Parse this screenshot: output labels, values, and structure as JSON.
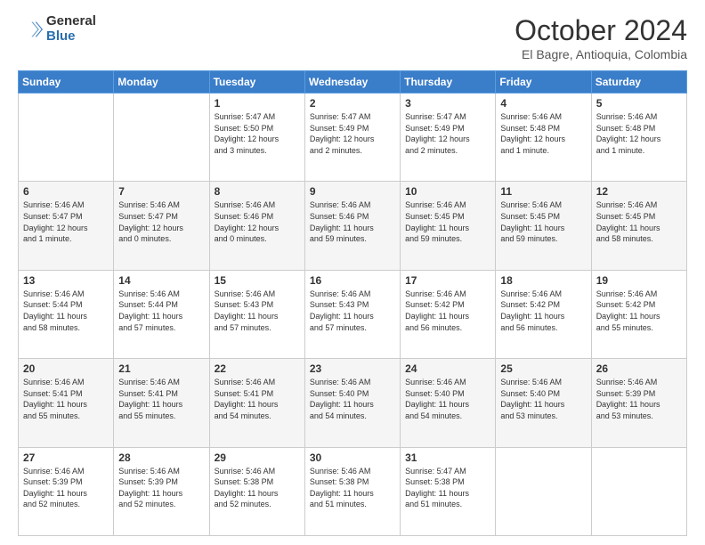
{
  "header": {
    "logo": {
      "general": "General",
      "blue": "Blue"
    },
    "title": "October 2024",
    "location": "El Bagre, Antioquia, Colombia"
  },
  "days_of_week": [
    "Sunday",
    "Monday",
    "Tuesday",
    "Wednesday",
    "Thursday",
    "Friday",
    "Saturday"
  ],
  "weeks": [
    [
      {
        "day": "",
        "content": ""
      },
      {
        "day": "",
        "content": ""
      },
      {
        "day": "1",
        "content": "Sunrise: 5:47 AM\nSunset: 5:50 PM\nDaylight: 12 hours\nand 3 minutes."
      },
      {
        "day": "2",
        "content": "Sunrise: 5:47 AM\nSunset: 5:49 PM\nDaylight: 12 hours\nand 2 minutes."
      },
      {
        "day": "3",
        "content": "Sunrise: 5:47 AM\nSunset: 5:49 PM\nDaylight: 12 hours\nand 2 minutes."
      },
      {
        "day": "4",
        "content": "Sunrise: 5:46 AM\nSunset: 5:48 PM\nDaylight: 12 hours\nand 1 minute."
      },
      {
        "day": "5",
        "content": "Sunrise: 5:46 AM\nSunset: 5:48 PM\nDaylight: 12 hours\nand 1 minute."
      }
    ],
    [
      {
        "day": "6",
        "content": "Sunrise: 5:46 AM\nSunset: 5:47 PM\nDaylight: 12 hours\nand 1 minute."
      },
      {
        "day": "7",
        "content": "Sunrise: 5:46 AM\nSunset: 5:47 PM\nDaylight: 12 hours\nand 0 minutes."
      },
      {
        "day": "8",
        "content": "Sunrise: 5:46 AM\nSunset: 5:46 PM\nDaylight: 12 hours\nand 0 minutes."
      },
      {
        "day": "9",
        "content": "Sunrise: 5:46 AM\nSunset: 5:46 PM\nDaylight: 11 hours\nand 59 minutes."
      },
      {
        "day": "10",
        "content": "Sunrise: 5:46 AM\nSunset: 5:45 PM\nDaylight: 11 hours\nand 59 minutes."
      },
      {
        "day": "11",
        "content": "Sunrise: 5:46 AM\nSunset: 5:45 PM\nDaylight: 11 hours\nand 59 minutes."
      },
      {
        "day": "12",
        "content": "Sunrise: 5:46 AM\nSunset: 5:45 PM\nDaylight: 11 hours\nand 58 minutes."
      }
    ],
    [
      {
        "day": "13",
        "content": "Sunrise: 5:46 AM\nSunset: 5:44 PM\nDaylight: 11 hours\nand 58 minutes."
      },
      {
        "day": "14",
        "content": "Sunrise: 5:46 AM\nSunset: 5:44 PM\nDaylight: 11 hours\nand 57 minutes."
      },
      {
        "day": "15",
        "content": "Sunrise: 5:46 AM\nSunset: 5:43 PM\nDaylight: 11 hours\nand 57 minutes."
      },
      {
        "day": "16",
        "content": "Sunrise: 5:46 AM\nSunset: 5:43 PM\nDaylight: 11 hours\nand 57 minutes."
      },
      {
        "day": "17",
        "content": "Sunrise: 5:46 AM\nSunset: 5:42 PM\nDaylight: 11 hours\nand 56 minutes."
      },
      {
        "day": "18",
        "content": "Sunrise: 5:46 AM\nSunset: 5:42 PM\nDaylight: 11 hours\nand 56 minutes."
      },
      {
        "day": "19",
        "content": "Sunrise: 5:46 AM\nSunset: 5:42 PM\nDaylight: 11 hours\nand 55 minutes."
      }
    ],
    [
      {
        "day": "20",
        "content": "Sunrise: 5:46 AM\nSunset: 5:41 PM\nDaylight: 11 hours\nand 55 minutes."
      },
      {
        "day": "21",
        "content": "Sunrise: 5:46 AM\nSunset: 5:41 PM\nDaylight: 11 hours\nand 55 minutes."
      },
      {
        "day": "22",
        "content": "Sunrise: 5:46 AM\nSunset: 5:41 PM\nDaylight: 11 hours\nand 54 minutes."
      },
      {
        "day": "23",
        "content": "Sunrise: 5:46 AM\nSunset: 5:40 PM\nDaylight: 11 hours\nand 54 minutes."
      },
      {
        "day": "24",
        "content": "Sunrise: 5:46 AM\nSunset: 5:40 PM\nDaylight: 11 hours\nand 54 minutes."
      },
      {
        "day": "25",
        "content": "Sunrise: 5:46 AM\nSunset: 5:40 PM\nDaylight: 11 hours\nand 53 minutes."
      },
      {
        "day": "26",
        "content": "Sunrise: 5:46 AM\nSunset: 5:39 PM\nDaylight: 11 hours\nand 53 minutes."
      }
    ],
    [
      {
        "day": "27",
        "content": "Sunrise: 5:46 AM\nSunset: 5:39 PM\nDaylight: 11 hours\nand 52 minutes."
      },
      {
        "day": "28",
        "content": "Sunrise: 5:46 AM\nSunset: 5:39 PM\nDaylight: 11 hours\nand 52 minutes."
      },
      {
        "day": "29",
        "content": "Sunrise: 5:46 AM\nSunset: 5:38 PM\nDaylight: 11 hours\nand 52 minutes."
      },
      {
        "day": "30",
        "content": "Sunrise: 5:46 AM\nSunset: 5:38 PM\nDaylight: 11 hours\nand 51 minutes."
      },
      {
        "day": "31",
        "content": "Sunrise: 5:47 AM\nSunset: 5:38 PM\nDaylight: 11 hours\nand 51 minutes."
      },
      {
        "day": "",
        "content": ""
      },
      {
        "day": "",
        "content": ""
      }
    ]
  ]
}
